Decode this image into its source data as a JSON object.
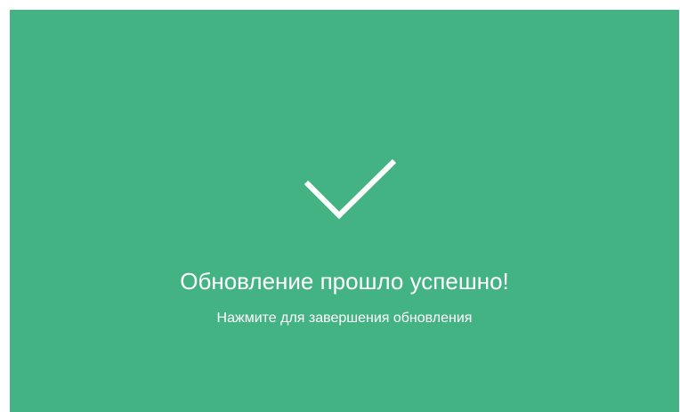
{
  "update_complete": {
    "icon": "checkmark-icon",
    "title": "Обновление прошло успешно!",
    "subtitle": "Нажмите для завершения обновления",
    "background_color": "#44b384",
    "text_color": "#ffffff"
  }
}
